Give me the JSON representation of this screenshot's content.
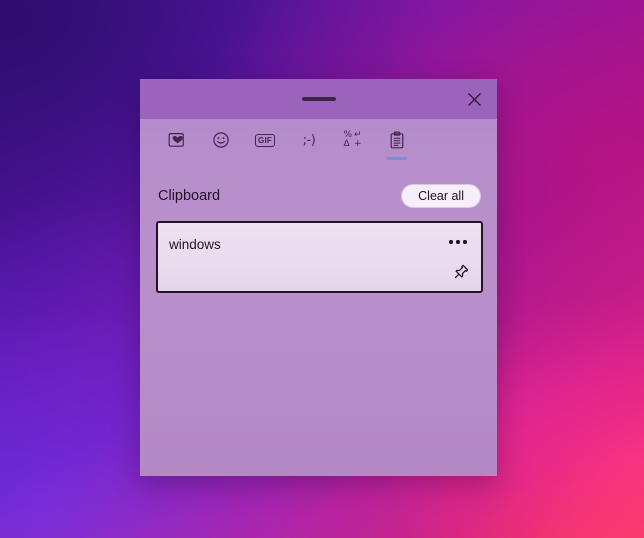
{
  "desktop": {
    "name": "windows-11-desktop-wallpaper",
    "colors": {
      "top_left": "#3b0f86",
      "mid": "#9c17a8",
      "bottom_right_accent": "#ff3c96",
      "flare": "#ff6e3c"
    }
  },
  "panel": {
    "name": "emoji-clipboard-panel",
    "titlebar": {
      "drag_handle": "drag-handle",
      "close_label": "Close",
      "close_icon": "close-icon"
    },
    "tabs": [
      {
        "id": "recently-used",
        "label": "Recently used",
        "icon": "heart-in-square-icon",
        "active": false
      },
      {
        "id": "emoji",
        "label": "Emoji",
        "icon": "smiley-face-icon",
        "active": false
      },
      {
        "id": "gif",
        "label": "GIF",
        "icon": "gif-icon",
        "glyph": "GIF",
        "active": false
      },
      {
        "id": "kaomoji",
        "label": "Kaomoji",
        "icon": "kaomoji-icon",
        "glyph": ";-)",
        "active": false
      },
      {
        "id": "symbols",
        "label": "Symbols",
        "icon": "symbols-icon",
        "glyphs": [
          "%",
          "↵",
          "Δ",
          "+"
        ],
        "active": false
      },
      {
        "id": "clipboard",
        "label": "Clipboard",
        "icon": "clipboard-icon",
        "active": true
      }
    ],
    "active_tab_underline_color": "#7b8fd4",
    "section": {
      "title": "Clipboard",
      "clear_all_label": "Clear all"
    },
    "clipboard_items": [
      {
        "text": "windows",
        "menu_icon": "more-options-icon",
        "pin_icon": "pin-icon",
        "focused": true
      }
    ]
  }
}
